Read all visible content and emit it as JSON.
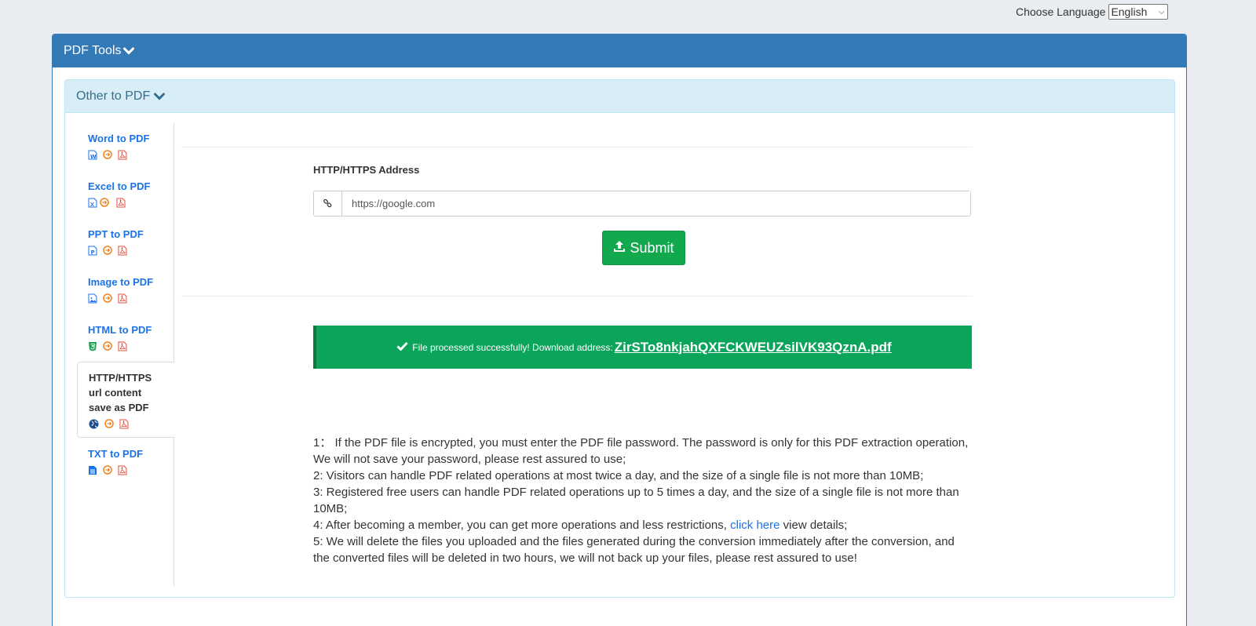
{
  "language": {
    "label": "Choose Language",
    "selected": "English"
  },
  "panel": {
    "title": "PDF Tools"
  },
  "section": {
    "title": "Other to PDF"
  },
  "sidebar": {
    "items": [
      {
        "label": "Word to PDF",
        "icon": "word-file-icon"
      },
      {
        "label": "Excel to PDF",
        "icon": "excel-file-icon"
      },
      {
        "label": "PPT to PDF",
        "icon": "ppt-file-icon"
      },
      {
        "label": "Image to PDF",
        "icon": "image-file-icon"
      },
      {
        "label": "HTML to PDF",
        "icon": "html5-icon"
      },
      {
        "label": "HTTP/HTTPS url content save as PDF",
        "icon": "globe-icon",
        "active": true
      },
      {
        "label": "TXT to PDF",
        "icon": "text-file-icon"
      }
    ]
  },
  "form": {
    "label": "HTTP/HTTPS Address",
    "url_value": "https://google.com",
    "submit_label": "Submit"
  },
  "alert": {
    "message": "File processed successfully! Download address:",
    "link_text": "ZirSTo8nkjahQXFCKWEUZsilVK93QznA.pdf"
  },
  "notes": {
    "n1": "1：  If the PDF file is encrypted, you must enter the PDF file password. The password is only for this PDF extraction operation, We will not save your password, please rest assured to use;",
    "n2": "2: Visitors can handle PDF related operations at most twice a day, and the size of a single file is not more than 10MB;",
    "n3": "3: Registered free users can handle PDF related operations up to 5 times a day, and the size of a single file is not more than 10MB;",
    "n4_before": "4: After becoming a member, you can get more operations and less restrictions,",
    "n4_link": "click here",
    "n4_after": "view details;",
    "n5": "5: We will delete the files you uploaded and the files generated during the conversion immediately after the conversion, and the converted files will be deleted in two hours, we will not back up your files, please rest assured to use!"
  }
}
